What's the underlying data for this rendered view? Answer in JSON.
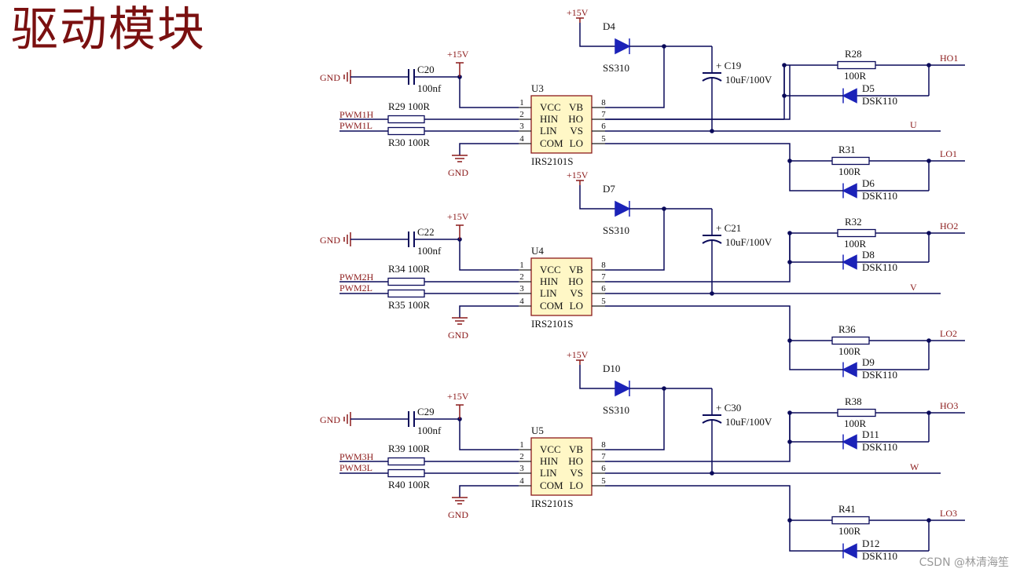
{
  "title": "驱动模块",
  "watermark": "CSDN @林清海笙",
  "stages": [
    {
      "chip": "U3",
      "part": "IRS2101S",
      "boot_diode": "D4",
      "boot_diode_part": "SS310",
      "cap_in": "C20",
      "cap_in_val": "100nf",
      "cap_boot": "C19",
      "cap_boot_val": "10uF/100V",
      "r_in_h": "R29",
      "r_in_h_val": "100R",
      "r_in_l": "R30",
      "r_in_l_val": "100R",
      "pwm_h": "PWM1H",
      "pwm_l": "PWM1L",
      "r_ho": "R28",
      "r_ho_val": "100R",
      "d_ho": "D5",
      "d_ho_part": "DSK110",
      "r_lo": "R31",
      "r_lo_val": "100R",
      "d_lo": "D6",
      "d_lo_part": "DSK110",
      "out_h": "HO1",
      "out_l": "LO1",
      "phase": "U"
    },
    {
      "chip": "U4",
      "part": "IRS2101S",
      "boot_diode": "D7",
      "boot_diode_part": "SS310",
      "cap_in": "C22",
      "cap_in_val": "100nf",
      "cap_boot": "C21",
      "cap_boot_val": "10uF/100V",
      "r_in_h": "R34",
      "r_in_h_val": "100R",
      "r_in_l": "R35",
      "r_in_l_val": "100R",
      "pwm_h": "PWM2H",
      "pwm_l": "PWM2L",
      "r_ho": "R32",
      "r_ho_val": "100R",
      "d_ho": "D8",
      "d_ho_part": "DSK110",
      "r_lo": "R36",
      "r_lo_val": "100R",
      "d_lo": "D9",
      "d_lo_part": "DSK110",
      "out_h": "HO2",
      "out_l": "LO2",
      "phase": "V"
    },
    {
      "chip": "U5",
      "part": "IRS2101S",
      "boot_diode": "D10",
      "boot_diode_part": "SS310",
      "cap_in": "C29",
      "cap_in_val": "100nf",
      "cap_boot": "C30",
      "cap_boot_val": "10uF/100V",
      "r_in_h": "R39",
      "r_in_h_val": "100R",
      "r_in_l": "R40",
      "r_in_l_val": "100R",
      "pwm_h": "PWM3H",
      "pwm_l": "PWM3L",
      "r_ho": "R38",
      "r_ho_val": "100R",
      "d_ho": "D11",
      "d_ho_part": "DSK110",
      "r_lo": "R41",
      "r_lo_val": "100R",
      "d_lo": "D12",
      "d_lo_part": "DSK110",
      "out_h": "HO3",
      "out_l": "LO3",
      "phase": "W"
    }
  ],
  "labels": {
    "supply": "+15V",
    "gnd": "GND",
    "cap_plus": "+"
  },
  "pins": {
    "left": [
      {
        "num": "1",
        "name": "VCC"
      },
      {
        "num": "2",
        "name": "HIN"
      },
      {
        "num": "3",
        "name": "LIN"
      },
      {
        "num": "4",
        "name": "COM"
      }
    ],
    "right": [
      {
        "num": "8",
        "name": "VB"
      },
      {
        "num": "7",
        "name": "HO"
      },
      {
        "num": "6",
        "name": "VS"
      },
      {
        "num": "5",
        "name": "LO"
      }
    ]
  }
}
